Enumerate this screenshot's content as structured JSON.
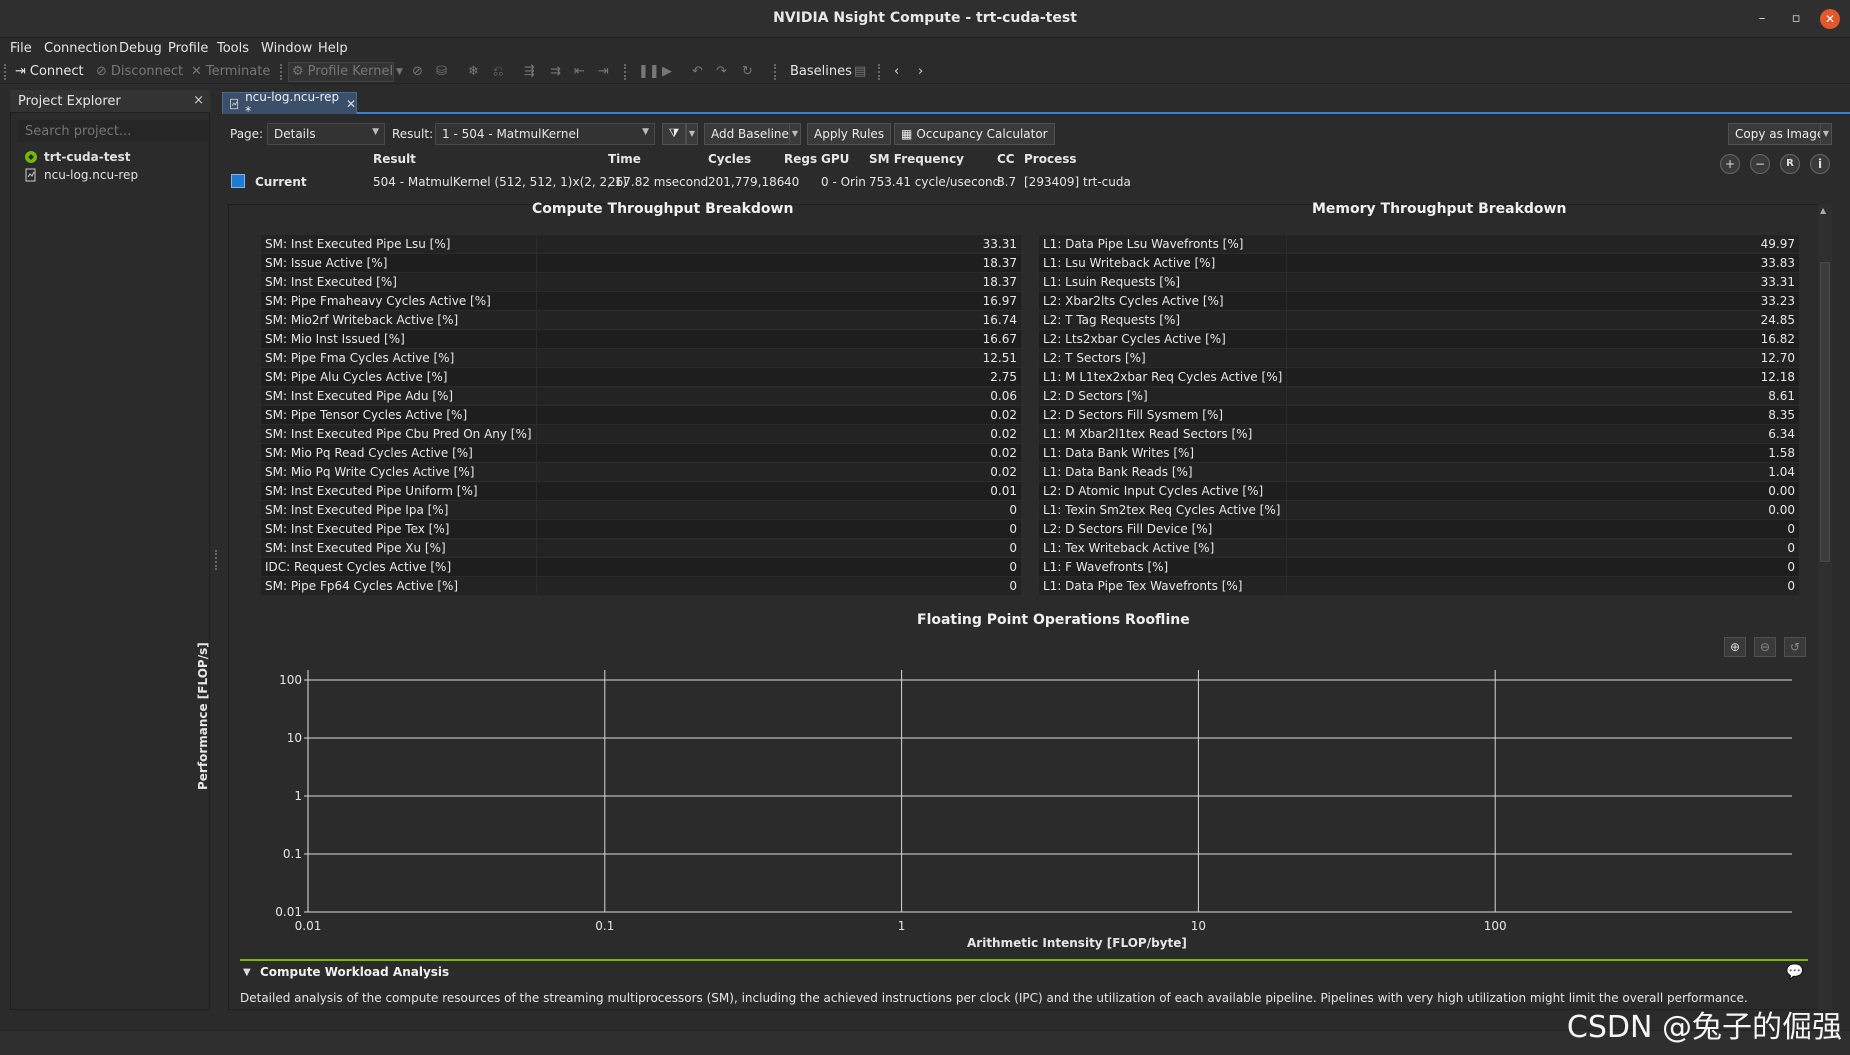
{
  "window": {
    "title": "NVIDIA Nsight Compute - trt-cuda-test",
    "minimize_icon": "–",
    "maximize_icon": "▫",
    "close_icon": "✕"
  },
  "menu": [
    "File",
    "Connection",
    "Debug",
    "Profile",
    "Tools",
    "Window",
    "Help"
  ],
  "toolbar": {
    "connect": "Connect",
    "disconnect": "Disconnect",
    "terminate": "Terminate",
    "profile_kernel": "Profile Kernel",
    "baselines": "Baselines"
  },
  "explorer": {
    "title": "Project Explorer",
    "close": "×",
    "search_placeholder": "Search project...",
    "items": [
      "trt-cuda-test",
      "ncu-log.ncu-rep"
    ]
  },
  "tab": {
    "label": "ncu-log.ncu-rep *",
    "close": "✕"
  },
  "controls": {
    "page_label": "Page:",
    "page_value": "Details",
    "result_label": "Result:",
    "result_value": "1 -   504 - MatmulKernel",
    "add_baseline": "Add Baseline",
    "apply_rules": "Apply Rules",
    "occupancy_calculator": "Occupancy Calculator",
    "copy_as_image": "Copy as Image"
  },
  "result_header": {
    "columns": [
      "Result",
      "Time",
      "Cycles",
      "Regs",
      "GPU",
      "SM Frequency",
      "CC",
      "Process"
    ],
    "current_label": "Current",
    "current_color": "#1f7ad1",
    "values": [
      "504 - MatmulKernel (512, 512, 1)x(2, 2, 1)",
      "267.82 msecond",
      "201,779,186",
      "40",
      "0 - Orin",
      "753.41 cycle/usecond",
      "8.7",
      "[293409] trt-cuda"
    ],
    "icons": [
      "+",
      "−",
      "R",
      "i"
    ]
  },
  "compute": {
    "title": "Compute Throughput Breakdown",
    "rows": [
      [
        "SM: Inst Executed Pipe Lsu [%]",
        "33.31"
      ],
      [
        "SM: Issue Active [%]",
        "18.37"
      ],
      [
        "SM: Inst Executed [%]",
        "18.37"
      ],
      [
        "SM: Pipe Fmaheavy Cycles Active [%]",
        "16.97"
      ],
      [
        "SM: Mio2rf Writeback Active [%]",
        "16.74"
      ],
      [
        "SM: Mio Inst Issued [%]",
        "16.67"
      ],
      [
        "SM: Pipe Fma Cycles Active [%]",
        "12.51"
      ],
      [
        "SM: Pipe Alu Cycles Active [%]",
        "2.75"
      ],
      [
        "SM: Inst Executed Pipe Adu [%]",
        "0.06"
      ],
      [
        "SM: Pipe Tensor Cycles Active [%]",
        "0.02"
      ],
      [
        "SM: Inst Executed Pipe Cbu Pred On Any [%]",
        "0.02"
      ],
      [
        "SM: Mio Pq Read Cycles Active [%]",
        "0.02"
      ],
      [
        "SM: Mio Pq Write Cycles Active [%]",
        "0.02"
      ],
      [
        "SM: Inst Executed Pipe Uniform [%]",
        "0.01"
      ],
      [
        "SM: Inst Executed Pipe Ipa [%]",
        "0"
      ],
      [
        "SM: Inst Executed Pipe Tex [%]",
        "0"
      ],
      [
        "SM: Inst Executed Pipe Xu [%]",
        "0"
      ],
      [
        "IDC: Request Cycles Active [%]",
        "0"
      ],
      [
        "SM: Pipe Fp64 Cycles Active [%]",
        "0"
      ]
    ]
  },
  "memory": {
    "title": "Memory Throughput Breakdown",
    "rows": [
      [
        "L1: Data Pipe Lsu Wavefronts [%]",
        "49.97"
      ],
      [
        "L1: Lsu Writeback Active [%]",
        "33.83"
      ],
      [
        "L1: Lsuin Requests [%]",
        "33.31"
      ],
      [
        "L2: Xbar2lts Cycles Active [%]",
        "33.23"
      ],
      [
        "L2: T Tag Requests [%]",
        "24.85"
      ],
      [
        "L2: Lts2xbar Cycles Active [%]",
        "16.82"
      ],
      [
        "L2: T Sectors [%]",
        "12.70"
      ],
      [
        "L1: M L1tex2xbar Req Cycles Active [%]",
        "12.18"
      ],
      [
        "L2: D Sectors [%]",
        "8.61"
      ],
      [
        "L2: D Sectors Fill Sysmem [%]",
        "8.35"
      ],
      [
        "L1: M Xbar2l1tex Read Sectors [%]",
        "6.34"
      ],
      [
        "L1: Data Bank Writes [%]",
        "1.58"
      ],
      [
        "L1: Data Bank Reads [%]",
        "1.04"
      ],
      [
        "L2: D Atomic Input Cycles Active [%]",
        "0.00"
      ],
      [
        "L1: Texin Sm2tex Req Cycles Active [%]",
        "0.00"
      ],
      [
        "L2: D Sectors Fill Device [%]",
        "0"
      ],
      [
        "L1: Tex Writeback Active [%]",
        "0"
      ],
      [
        "L1: F Wavefronts [%]",
        "0"
      ],
      [
        "L1: Data Pipe Tex Wavefronts [%]",
        "0"
      ]
    ]
  },
  "chart_data": {
    "type": "line",
    "title": "Floating Point Operations Roofline",
    "xlabel": "Arithmetic Intensity [FLOP/byte]",
    "ylabel": "Performance [FLOP/s]",
    "x_scale": "log",
    "y_scale": "log",
    "xlim": [
      0.01,
      1000
    ],
    "ylim": [
      0.01,
      1000
    ],
    "x_ticks": [
      "0.01",
      "0.1",
      "1",
      "10",
      "100"
    ],
    "y_ticks": [
      "0.01",
      "0.1",
      "1",
      "10",
      "100"
    ],
    "grid": true,
    "series": []
  },
  "roof_zoom_icons": [
    "⊕",
    "⊖",
    "↺"
  ],
  "cwa": {
    "title": "Compute Workload Analysis",
    "description": "Detailed analysis of the compute resources of the streaming multiprocessors (SM), including the achieved instructions per clock (IPC) and the utilization of each available pipeline. Pipelines with very high utilization might limit the overall performance."
  },
  "watermark": "CSDN @兔子的倔强"
}
